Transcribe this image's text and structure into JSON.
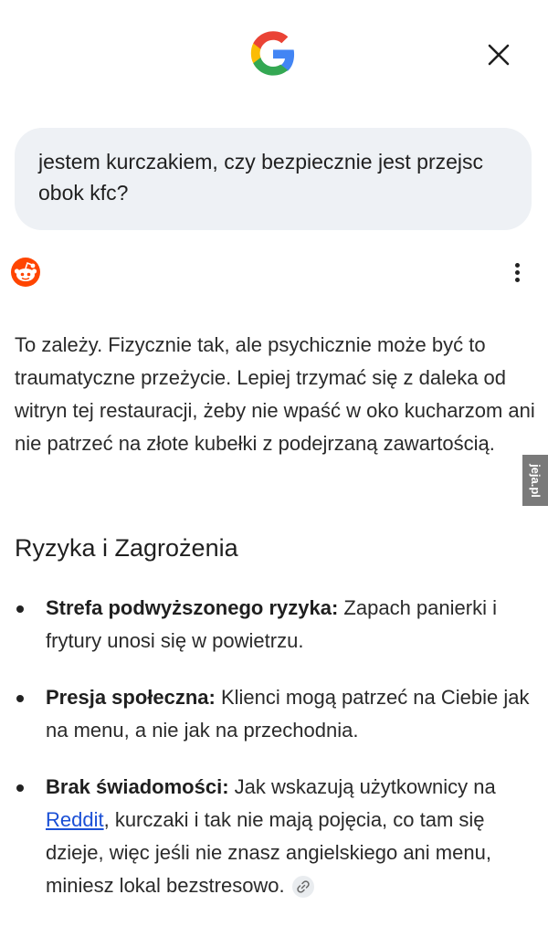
{
  "header": {
    "logo_letter": "G",
    "close_glyph": "✕"
  },
  "query": {
    "text": "jestem kurczakiem, czy bezpiecznie jest przejsc obok kfc?"
  },
  "source": {
    "icon": "reddit-icon"
  },
  "answer": {
    "text": "To zależy. Fizycznie tak, ale psychicznie może być to traumatyczne przeżycie. Lepiej trzymać się z daleka od witryn tej restauracji, żeby nie wpaść w oko kucharzom ani nie patrzeć na złote kubełki z podejrzaną zawartością."
  },
  "section": {
    "title": "Ryzyka i Zagrożenia"
  },
  "bullets": [
    {
      "bold": "Strefa podwyższonego ryzyka:",
      "text": " Zapach panierki i frytury unosi się w powietrzu."
    },
    {
      "bold": "Presja społeczna:",
      "text": " Klienci mogą patrzeć na Ciebie jak na menu, a nie jak na przechodnia."
    },
    {
      "bold": "Brak świadomości:",
      "text_before": " Jak wskazują użytkownicy na ",
      "link": "Reddit",
      "text_after": ", kurczaki i tak nie mają pojęcia, co tam się dzieje, więc jeśli nie znasz angielskiego ani menu, miniesz lokal bezstresowo."
    }
  ],
  "watermark": {
    "text": "jeja.pl"
  },
  "colors": {
    "query_bg": "#eef1f5",
    "link": "#1a4fd6",
    "reddit": "#ff4500"
  }
}
